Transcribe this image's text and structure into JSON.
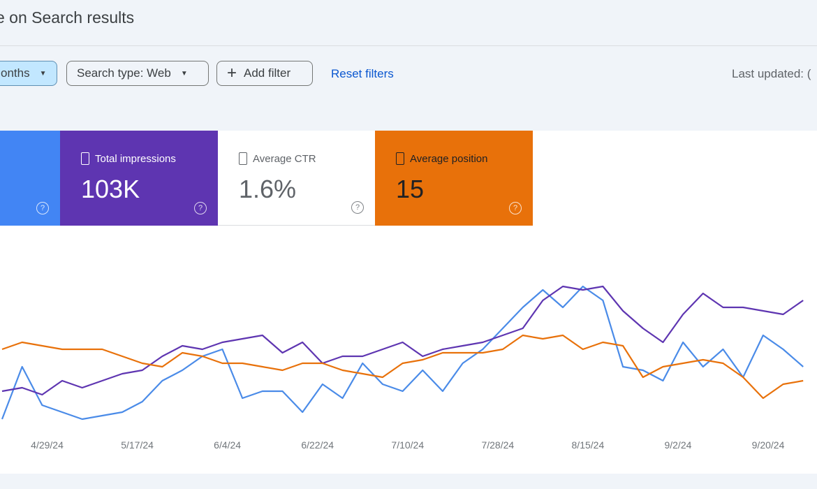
{
  "header": {
    "title": "e on Search results"
  },
  "filters": {
    "date_chip": "onths",
    "search_type_chip": "Search type: Web",
    "add_filter": "Add filter",
    "reset": "Reset filters",
    "last_updated": "Last updated: ("
  },
  "cards": [
    {
      "label": "",
      "value": "",
      "color": "#4285f4",
      "text_color": "#ffffff"
    },
    {
      "label": "Total impressions",
      "value": "103K",
      "color": "#5e35b1",
      "text_color": "#ffffff"
    },
    {
      "label": "Average CTR",
      "value": "1.6%",
      "color": "#ffffff",
      "text_color": "#5f6368"
    },
    {
      "label": "Average position",
      "value": "15",
      "color": "#e8710a",
      "text_color": "#202124"
    }
  ],
  "chart_data": {
    "type": "line",
    "start_date": "2024-04-20",
    "step_days": 4,
    "x_ticks": [
      "4/29/24",
      "5/17/24",
      "6/4/24",
      "6/22/24",
      "7/10/24",
      "7/28/24",
      "8/15/24",
      "9/2/24",
      "9/20/24"
    ],
    "ylim": [
      0,
      100
    ],
    "grid": false,
    "series": [
      {
        "color": "#4a8be8",
        "values": [
          12,
          42,
          20,
          16,
          12,
          14,
          16,
          22,
          34,
          40,
          48,
          52,
          24,
          28,
          28,
          16,
          32,
          24,
          44,
          32,
          28,
          40,
          28,
          44,
          52,
          64,
          76,
          86,
          76,
          88,
          80,
          42,
          40,
          34,
          56,
          42,
          52,
          36,
          60,
          52,
          42
        ]
      },
      {
        "color": "#5e35b1",
        "values": [
          28,
          30,
          26,
          34,
          30,
          34,
          38,
          40,
          48,
          54,
          52,
          56,
          58,
          60,
          50,
          56,
          44,
          48,
          48,
          52,
          56,
          48,
          52,
          54,
          56,
          60,
          64,
          80,
          88,
          86,
          88,
          74,
          64,
          56,
          72,
          84,
          76,
          76,
          74,
          72,
          80
        ]
      },
      {
        "color": "#e8710a",
        "values": [
          52,
          56,
          54,
          52,
          52,
          52,
          48,
          44,
          42,
          50,
          48,
          44,
          44,
          42,
          40,
          44,
          44,
          40,
          38,
          36,
          44,
          46,
          50,
          50,
          50,
          52,
          60,
          58,
          60,
          52,
          56,
          54,
          36,
          42,
          44,
          46,
          44,
          36,
          24,
          32,
          34
        ]
      }
    ]
  }
}
